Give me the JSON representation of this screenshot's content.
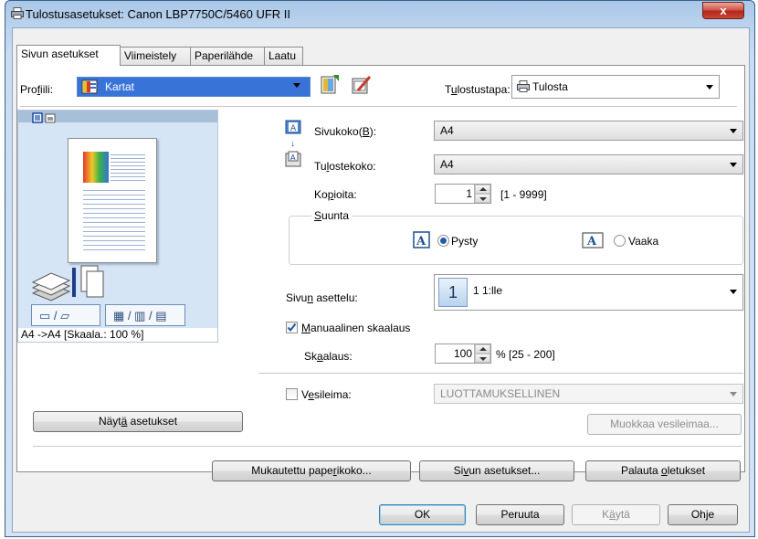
{
  "window": {
    "title": "Tulostusasetukset: Canon LBP7750C/5460 UFR II",
    "close_label": "x"
  },
  "tabs": [
    {
      "label": "Sivun asetukset"
    },
    {
      "label": "Viimeistely"
    },
    {
      "label": "Paperilähde"
    },
    {
      "label": "Laatu"
    }
  ],
  "profile": {
    "label_pre": "Pro",
    "label_ul": "f",
    "label_post": "iili:",
    "value": "Kartat"
  },
  "output_method": {
    "label_pre": "T",
    "label_ul": "u",
    "label_post": "lostustapa:",
    "value": "Tulosta"
  },
  "preview": {
    "caption": "A4 ->A4 [Skaala.: 100 %]"
  },
  "page_size": {
    "label_pre": "Sivukoko(",
    "label_ul": "B",
    "label_post": "):",
    "value": "A4"
  },
  "output_size": {
    "label_pre": "Tu",
    "label_ul": "l",
    "label_post": "ostekoko:",
    "value": "A4"
  },
  "copies": {
    "label_pre": "Ko",
    "label_ul": "p",
    "label_post": "ioita:",
    "value": "1",
    "range": "[1 - 9999]"
  },
  "orientation": {
    "group_ul": "S",
    "group_post": "uunta",
    "portrait": "Pysty",
    "landscape": "Vaaka",
    "selected": "portrait"
  },
  "page_layout": {
    "label_pre": "Sivu",
    "label_ul": "n",
    "label_post": " asettelu:",
    "icon_digit": "1",
    "value": "1 1:lle"
  },
  "manual_scaling": {
    "label_ul": "M",
    "label_post": "anuaalinen skaalaus",
    "checked": true
  },
  "scaling": {
    "label_pre": "Sk",
    "label_ul": "a",
    "label_post": "alaus:",
    "value": "100",
    "range": "% [25 - 200]"
  },
  "watermark": {
    "label_pre": "V",
    "label_ul": "e",
    "label_post": "sileima:",
    "checked": false,
    "value": "LUOTTAMUKSELLINEN",
    "edit_label": "Muokkaa vesileimaa..."
  },
  "buttons": {
    "show_settings_pre": "Näyt",
    "show_settings_ul": "ä",
    "show_settings_post": " asetukset",
    "custom_paper_pre": "Mukautettu pape",
    "custom_paper_ul": "r",
    "custom_paper_post": "ikoko...",
    "page_setup_pre": "Si",
    "page_setup_ul": "v",
    "page_setup_post": "un asetukset...",
    "restore_pre": "Palauta ",
    "restore_ul": "o",
    "restore_post": "letukset",
    "ok": "OK",
    "cancel": "Peruuta",
    "apply_pre": "K",
    "apply_ul": "ä",
    "apply_post": "ytä",
    "help": "Ohje"
  }
}
